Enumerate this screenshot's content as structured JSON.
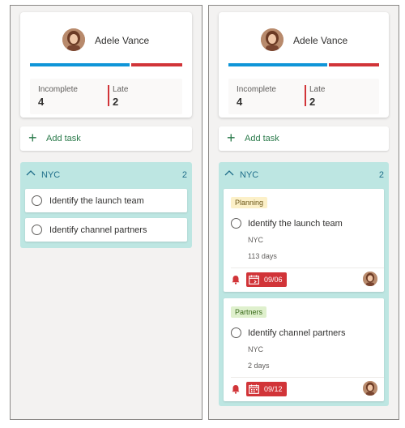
{
  "user": {
    "name": "Adele Vance",
    "progress_completed_fraction": 0.66,
    "progress_late_fraction": 0.34
  },
  "stats": {
    "incomplete_label": "Incomplete",
    "incomplete_value": "4",
    "late_label": "Late",
    "late_value": "2"
  },
  "add_task_label": "Add task",
  "bucket": {
    "name": "NYC",
    "count": "2"
  },
  "compact_tasks": [
    {
      "title": "Identify the launch team"
    },
    {
      "title": "Identify channel partners"
    }
  ],
  "detailed_tasks": [
    {
      "tag": "Planning",
      "title": "Identify the launch team",
      "location": "NYC",
      "days": "113 days",
      "due": "09/06"
    },
    {
      "tag": "Partners",
      "title": "Identify channel partners",
      "location": "NYC",
      "days": "2 days",
      "due": "09/12"
    }
  ],
  "colors": {
    "progress_blue": "#0f95d8",
    "late_red": "#d13438",
    "bucket_bg": "#bde6e2",
    "add_green": "#2a7a4a"
  }
}
